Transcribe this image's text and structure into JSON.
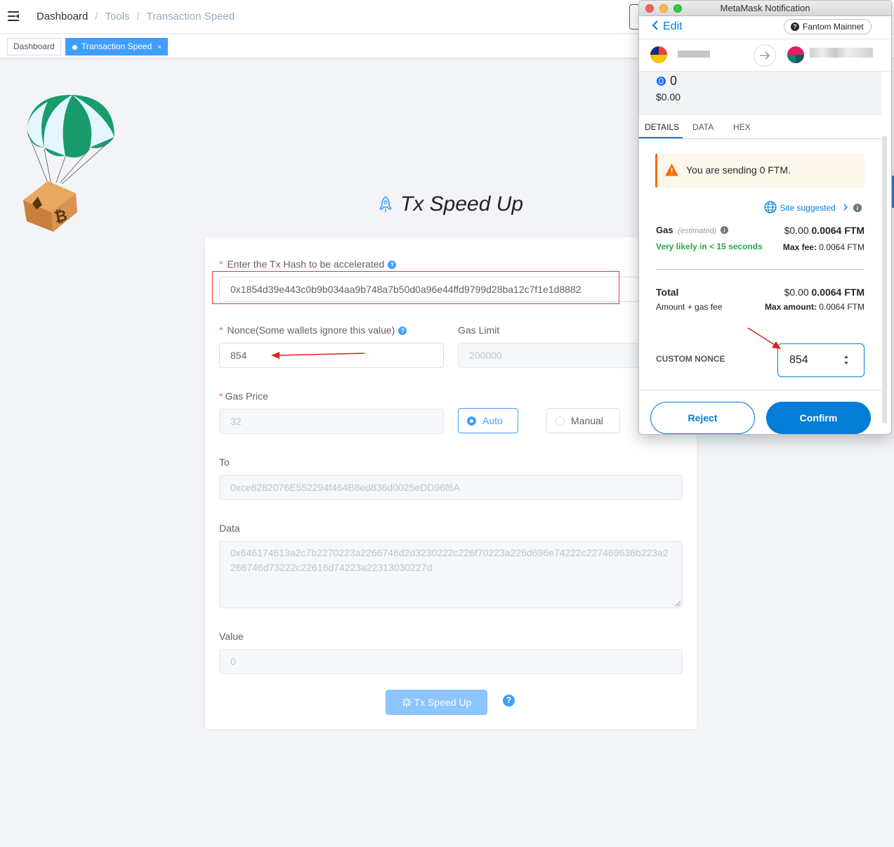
{
  "navbar": {
    "breadcrumb": [
      "Dashboard",
      "Tools",
      "Transaction Speed"
    ],
    "separator": "/"
  },
  "tags": {
    "items": [
      "Dashboard",
      "Transaction Speed"
    ],
    "close": "×"
  },
  "page": {
    "title": "Tx Speed Up"
  },
  "form": {
    "tx_hash_label": "Enter the Tx Hash to be accelerated",
    "tx_hash_value": "0x1854d39e443c0b9b034aa9b748a7b50d0a96e44ffd9799d28ba12c7f1e1d8882",
    "nonce_label": "Nonce(Some wallets ignore this value)",
    "nonce_value": "854",
    "gas_limit_label": "Gas Limit",
    "gas_limit_value": "200000",
    "gas_price_label": "Gas Price",
    "gas_price_value": "32",
    "gas_mode_auto": "Auto",
    "gas_mode_manual": "Manual",
    "gas_mode_selected": "Auto",
    "to_label": "To",
    "to_value": "0xce8282076E552294f464B8ed836d0025eDD96f6A",
    "data_label": "Data",
    "data_value": "0x646174613a2c7b2270223a2266746d2d3230222c226f70223a226d696e74222c227469636b223a2266746d73222c22616d74223a22313030227d",
    "value_label": "Value",
    "value_value": "0",
    "submit_label": "Tx Speed Up",
    "required_mark": "*",
    "help_mark": "?"
  },
  "metamask": {
    "window_title": "MetaMask Notification",
    "back_label": "Edit",
    "network": "Fantom Mainnet",
    "amount": "0",
    "amount_fiat": "$0.00",
    "tabs": [
      "DETAILS",
      "DATA",
      "HEX"
    ],
    "active_tab": "DETAILS",
    "warning": "You are sending 0 FTM.",
    "site_suggested": "Site suggested",
    "gas_label": "Gas",
    "gas_estimated": "(estimated)",
    "gas_fiat": "$0.00",
    "gas_ftm": "0.0064 FTM",
    "likely": "Very likely in < 15 seconds",
    "max_fee_label": "Max fee:",
    "max_fee_value": "0.0064 FTM",
    "total_label": "Total",
    "total_fiat": "$0.00",
    "total_ftm": "0.0064 FTM",
    "amount_gas_fee": "Amount + gas fee",
    "max_amount_label": "Max amount:",
    "max_amount_value": "0.0064 FTM",
    "custom_nonce_label": "CUSTOM NONCE",
    "custom_nonce_value": "854",
    "reject_label": "Reject",
    "confirm_label": "Confirm"
  },
  "colors": {
    "primary": "#409eff",
    "metamask_blue": "#037dd6",
    "annotation_red": "#e83a3a",
    "success_green": "#28a745",
    "warning_orange": "#f66a0a"
  }
}
